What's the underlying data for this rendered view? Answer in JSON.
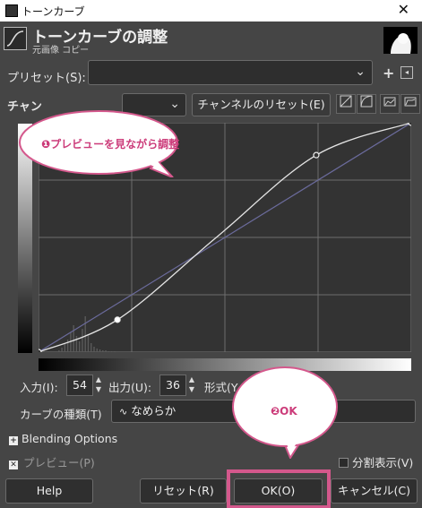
{
  "window": {
    "title": "トーンカーブ",
    "close_glyph": "✕"
  },
  "header": {
    "title": "トーンカーブの調整",
    "subtitle": "元画像 コピー"
  },
  "preset": {
    "label": "プリセット(S):",
    "value": "",
    "add_glyph": "+",
    "menu_glyph": "◂"
  },
  "channel": {
    "label": "チャン",
    "value": "",
    "reset_label": "チャンネルのリセット(E)"
  },
  "adjust": {
    "input_label": "入力(I):",
    "input_value": "54",
    "output_label": "出力(U):",
    "output_value": "36",
    "form_label": "形式(Y"
  },
  "curve_type": {
    "label": "カーブの種類(T)",
    "value": "なめらか"
  },
  "blending": {
    "label": "Blending Options",
    "glyph": "+"
  },
  "preview": {
    "label": "プレビュー(P)",
    "checked_glyph": "✕",
    "split_label": "分割表示(V)"
  },
  "buttons": {
    "help": "Help",
    "reset": "リセット(R)",
    "ok": "OK(O)",
    "cancel": "キャンセル(C)"
  },
  "annotations": {
    "bubble1": "❶プレビューを見ながら調整",
    "bubble2": "❷OK"
  },
  "chart_data": {
    "type": "line",
    "series": [
      {
        "role": "identity",
        "x": [
          0,
          255
        ],
        "y": [
          0,
          255
        ]
      },
      {
        "role": "curve",
        "x": [
          0,
          54,
          122,
          190,
          255
        ],
        "y": [
          0,
          36,
          128,
          219,
          255
        ]
      }
    ],
    "control_points": [
      [
        0,
        0
      ],
      [
        54,
        36
      ],
      [
        190,
        219
      ],
      [
        255,
        255
      ]
    ],
    "xlim": [
      0,
      255
    ],
    "ylim": [
      0,
      255
    ],
    "grid": true,
    "colors": {
      "background": "#333333",
      "grid": "#6e6e6e",
      "identity": "#6b6b9c",
      "curve": "#e4e4e4",
      "histogram": "#5a5a5a"
    }
  },
  "colors": {
    "accent_highlight": "#d4588c",
    "bubble_text": "#cc3c7a"
  }
}
